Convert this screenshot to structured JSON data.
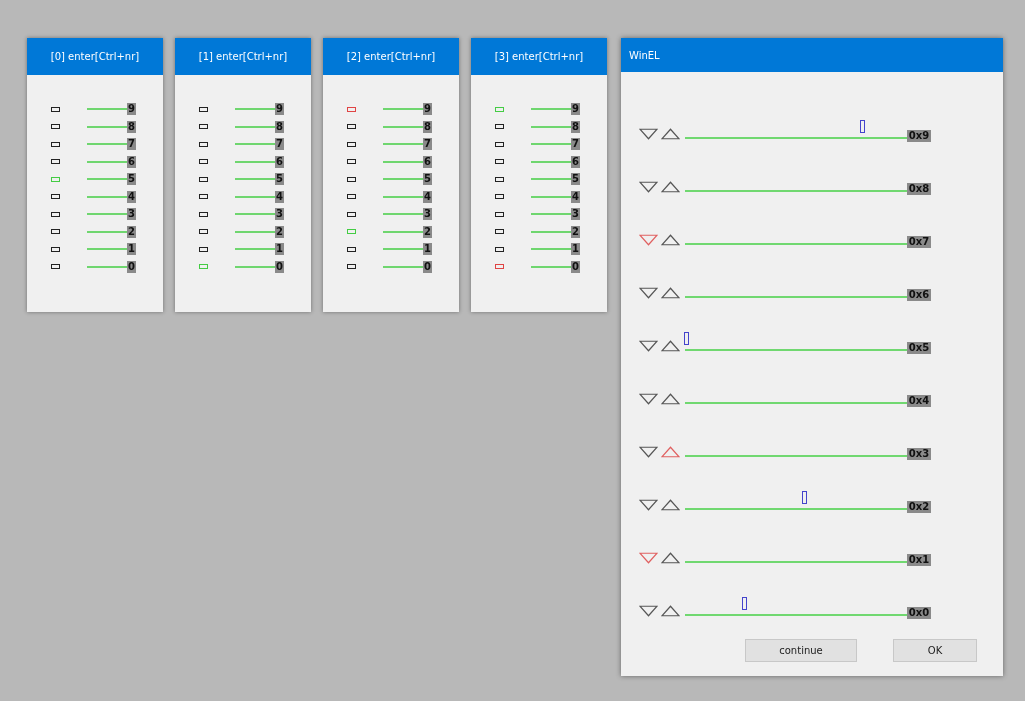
{
  "panels": [
    {
      "title": "[0] enter[Ctrl+nr]",
      "rows": [
        {
          "label": "9",
          "color": "#222222"
        },
        {
          "label": "8",
          "color": "#222222"
        },
        {
          "label": "7",
          "color": "#222222"
        },
        {
          "label": "6",
          "color": "#222222"
        },
        {
          "label": "5",
          "color": "#44cc44"
        },
        {
          "label": "4",
          "color": "#222222"
        },
        {
          "label": "3",
          "color": "#222222"
        },
        {
          "label": "2",
          "color": "#222222"
        },
        {
          "label": "1",
          "color": "#222222"
        },
        {
          "label": "0",
          "color": "#222222"
        }
      ]
    },
    {
      "title": "[1] enter[Ctrl+nr]",
      "rows": [
        {
          "label": "9",
          "color": "#222222"
        },
        {
          "label": "8",
          "color": "#222222"
        },
        {
          "label": "7",
          "color": "#222222"
        },
        {
          "label": "6",
          "color": "#222222"
        },
        {
          "label": "5",
          "color": "#222222"
        },
        {
          "label": "4",
          "color": "#222222"
        },
        {
          "label": "3",
          "color": "#222222"
        },
        {
          "label": "2",
          "color": "#222222"
        },
        {
          "label": "1",
          "color": "#222222"
        },
        {
          "label": "0",
          "color": "#44cc44"
        }
      ]
    },
    {
      "title": "[2] enter[Ctrl+nr]",
      "rows": [
        {
          "label": "9",
          "color": "#e04444"
        },
        {
          "label": "8",
          "color": "#222222"
        },
        {
          "label": "7",
          "color": "#222222"
        },
        {
          "label": "6",
          "color": "#222222"
        },
        {
          "label": "5",
          "color": "#222222"
        },
        {
          "label": "4",
          "color": "#222222"
        },
        {
          "label": "3",
          "color": "#222222"
        },
        {
          "label": "2",
          "color": "#44cc44"
        },
        {
          "label": "1",
          "color": "#222222"
        },
        {
          "label": "0",
          "color": "#222222"
        }
      ]
    },
    {
      "title": "[3] enter[Ctrl+nr]",
      "rows": [
        {
          "label": "9",
          "color": "#44cc44"
        },
        {
          "label": "8",
          "color": "#222222"
        },
        {
          "label": "7",
          "color": "#222222"
        },
        {
          "label": "6",
          "color": "#222222"
        },
        {
          "label": "5",
          "color": "#222222"
        },
        {
          "label": "4",
          "color": "#222222"
        },
        {
          "label": "3",
          "color": "#222222"
        },
        {
          "label": "2",
          "color": "#222222"
        },
        {
          "label": "1",
          "color": "#222222"
        },
        {
          "label": "0",
          "color": "#e04444"
        }
      ]
    }
  ],
  "window": {
    "title": "WinEL",
    "rows": [
      {
        "label": "0x9",
        "down_active": false,
        "up_active": false,
        "level": 0.8
      },
      {
        "label": "0x8",
        "down_active": false,
        "up_active": false
      },
      {
        "label": "0x7",
        "down_active": true,
        "up_active": false
      },
      {
        "label": "0x6",
        "down_active": false,
        "up_active": false
      },
      {
        "label": "0x5",
        "down_active": false,
        "up_active": false,
        "level": 0.01
      },
      {
        "label": "0x4",
        "down_active": false,
        "up_active": false
      },
      {
        "label": "0x3",
        "down_active": false,
        "up_active": true
      },
      {
        "label": "0x2",
        "down_active": false,
        "up_active": false,
        "level": 0.54
      },
      {
        "label": "0x1",
        "down_active": true,
        "up_active": false
      },
      {
        "label": "0x0",
        "down_active": false,
        "up_active": false,
        "level": 0.27
      }
    ],
    "buttons": [
      "continue",
      "OK"
    ]
  }
}
